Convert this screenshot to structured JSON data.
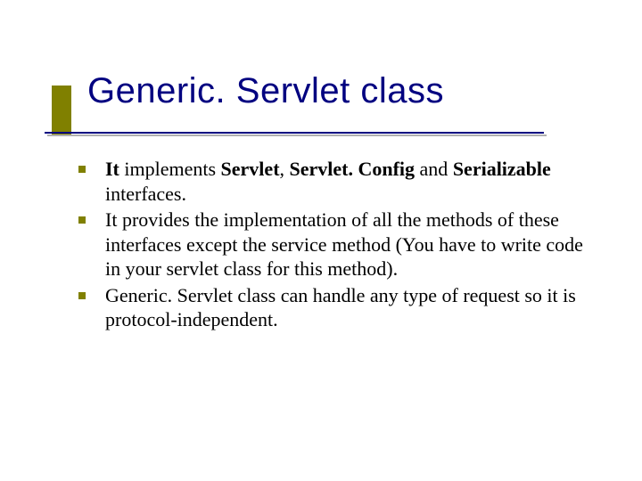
{
  "title": "Generic. Servlet class",
  "bullets": [
    {
      "parts": [
        {
          "t": "It",
          "bold": true
        },
        {
          "t": " implements ",
          "bold": false
        },
        {
          "t": "Servlet",
          "bold": true
        },
        {
          "t": ", ",
          "bold": false
        },
        {
          "t": "Servlet. Config",
          "bold": true
        },
        {
          "t": " and ",
          "bold": false
        },
        {
          "t": "Serializable",
          "bold": true
        },
        {
          "t": " interfaces.",
          "bold": false
        }
      ]
    },
    {
      "parts": [
        {
          "t": "It provides the implementation of all the  methods of these interfaces except the service  method (You have to write code in your servlet class for this method).",
          "bold": false
        }
      ]
    },
    {
      "parts": [
        {
          "t": "Generic. Servlet class can handle any type of  request so it is protocol-independent.",
          "bold": false
        }
      ]
    }
  ]
}
